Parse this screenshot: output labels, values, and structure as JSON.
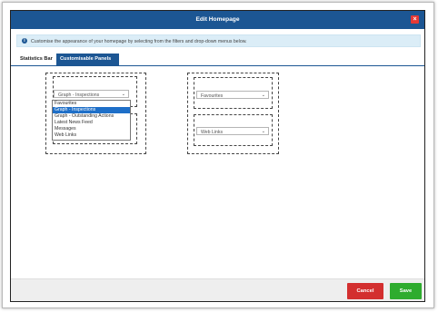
{
  "dialog": {
    "title": "Edit Homepage",
    "close_icon": "×"
  },
  "info": {
    "icon": "i",
    "text": "Customise the appearance of your homepage by selecting from the filters and drop-down menus below."
  },
  "tabs": [
    {
      "label": "Statistics Bar",
      "active": false
    },
    {
      "label": "Customisable Panels",
      "active": true
    }
  ],
  "left_panel": {
    "top_select": {
      "value": "Graph - Inspections"
    },
    "dropdown_options": [
      "Favourites",
      "Graph - Inspections",
      "Graph - Outstanding Actions",
      "Latest News Feed",
      "Messages",
      "Web Links"
    ],
    "dropdown_selected": "Graph - Inspections"
  },
  "right_panel": {
    "top_select": {
      "value": "Favourites"
    },
    "bottom_select": {
      "value": "Web Links"
    }
  },
  "footer": {
    "cancel_label": "Cancel",
    "save_label": "Save"
  },
  "colors": {
    "titlebar": "#1c5693",
    "close": "#e53935",
    "info_bg": "#dbedf7",
    "cancel": "#d32f2f",
    "save": "#2eac2e",
    "dropdown_highlight": "#1e6fc8"
  },
  "icons": {
    "close": "close-icon",
    "info": "info-icon",
    "chevron": "chevron-down-icon"
  }
}
